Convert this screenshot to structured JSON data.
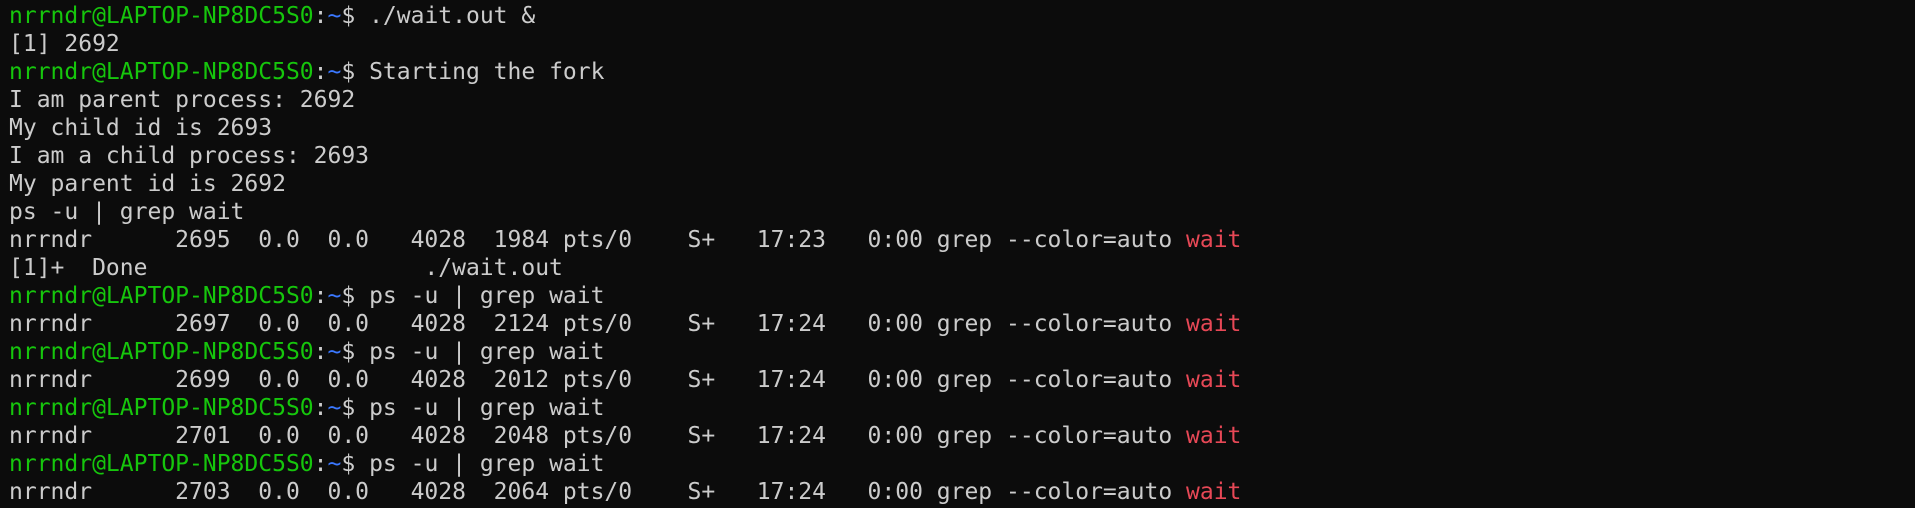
{
  "terminal": {
    "colors": {
      "background": "#0c0c0c",
      "foreground": "#cccccc",
      "prompt_user": "#16c60c",
      "prompt_path": "#3b78ff",
      "grep_match": "#e74856"
    },
    "lines": [
      {
        "type": "prompt",
        "user": "nrrndr@LAPTOP-NP8DC5S0",
        "sep": ":",
        "path": "~",
        "symbol": "$ ",
        "command": "./wait.out &"
      },
      {
        "type": "output",
        "text": "[1] 2692"
      },
      {
        "type": "prompt",
        "user": "nrrndr@LAPTOP-NP8DC5S0",
        "sep": ":",
        "path": "~",
        "symbol": "$ ",
        "command": "Starting the fork"
      },
      {
        "type": "output",
        "text": "I am parent process: 2692"
      },
      {
        "type": "output",
        "text": "My child id is 2693"
      },
      {
        "type": "output",
        "text": "I am a child process: 2693"
      },
      {
        "type": "output",
        "text": "My parent id is 2692"
      },
      {
        "type": "output",
        "text": "ps -u | grep wait"
      },
      {
        "type": "match",
        "before": "nrrndr      2695  0.0  0.0   4028  1984 pts/0    S+   17:23   0:00 grep --color=auto ",
        "match": "wait"
      },
      {
        "type": "output",
        "text": "[1]+  Done                    ./wait.out"
      },
      {
        "type": "prompt",
        "user": "nrrndr@LAPTOP-NP8DC5S0",
        "sep": ":",
        "path": "~",
        "symbol": "$ ",
        "command": "ps -u | grep wait"
      },
      {
        "type": "match",
        "before": "nrrndr      2697  0.0  0.0   4028  2124 pts/0    S+   17:24   0:00 grep --color=auto ",
        "match": "wait"
      },
      {
        "type": "prompt",
        "user": "nrrndr@LAPTOP-NP8DC5S0",
        "sep": ":",
        "path": "~",
        "symbol": "$ ",
        "command": "ps -u | grep wait"
      },
      {
        "type": "match",
        "before": "nrrndr      2699  0.0  0.0   4028  2012 pts/0    S+   17:24   0:00 grep --color=auto ",
        "match": "wait"
      },
      {
        "type": "prompt",
        "user": "nrrndr@LAPTOP-NP8DC5S0",
        "sep": ":",
        "path": "~",
        "symbol": "$ ",
        "command": "ps -u | grep wait"
      },
      {
        "type": "match",
        "before": "nrrndr      2701  0.0  0.0   4028  2048 pts/0    S+   17:24   0:00 grep --color=auto ",
        "match": "wait"
      },
      {
        "type": "prompt",
        "user": "nrrndr@LAPTOP-NP8DC5S0",
        "sep": ":",
        "path": "~",
        "symbol": "$ ",
        "command": "ps -u | grep wait"
      },
      {
        "type": "match",
        "before": "nrrndr      2703  0.0  0.0   4028  2064 pts/0    S+   17:24   0:00 grep --color=auto ",
        "match": "wait"
      }
    ]
  }
}
